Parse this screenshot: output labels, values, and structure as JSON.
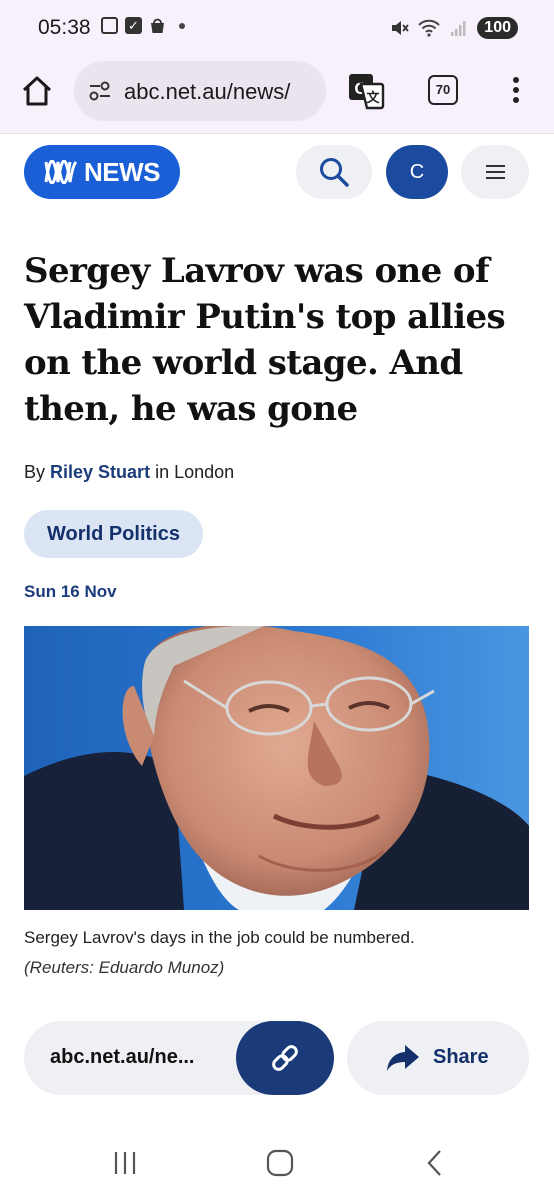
{
  "status_bar": {
    "time": "05:38",
    "battery": "100",
    "icons": [
      "screenshot-icon",
      "checkbox-icon",
      "shopping-bag-icon",
      "dot-icon",
      "mute-icon",
      "wifi-icon",
      "signal-icon",
      "battery-icon"
    ]
  },
  "browser": {
    "url": "abc.net.au/news/",
    "tab_count": "70"
  },
  "site_header": {
    "logo_text": "NEWS",
    "avatar_initial": "C"
  },
  "article": {
    "headline": "Sergey Lavrov was one of Vladimir Putin's top allies on the world stage. And then, he was gone",
    "byline_prefix": "By",
    "author": "Riley Stuart",
    "byline_suffix": "in London",
    "topic": "World Politics",
    "date": "Sun 16 Nov",
    "caption": "Sergey Lavrov's days in the job could be numbered.",
    "credit": "(Reuters: Eduardo Munoz)"
  },
  "share_bar": {
    "url_text": "abc.net.au/ne...",
    "share_label": "Share"
  },
  "colors": {
    "abc_blue": "#1a5fd6",
    "navy": "#1a3a7a",
    "pill_bg": "#dbe5f4",
    "chrome_bg": "#f8f0fb"
  }
}
